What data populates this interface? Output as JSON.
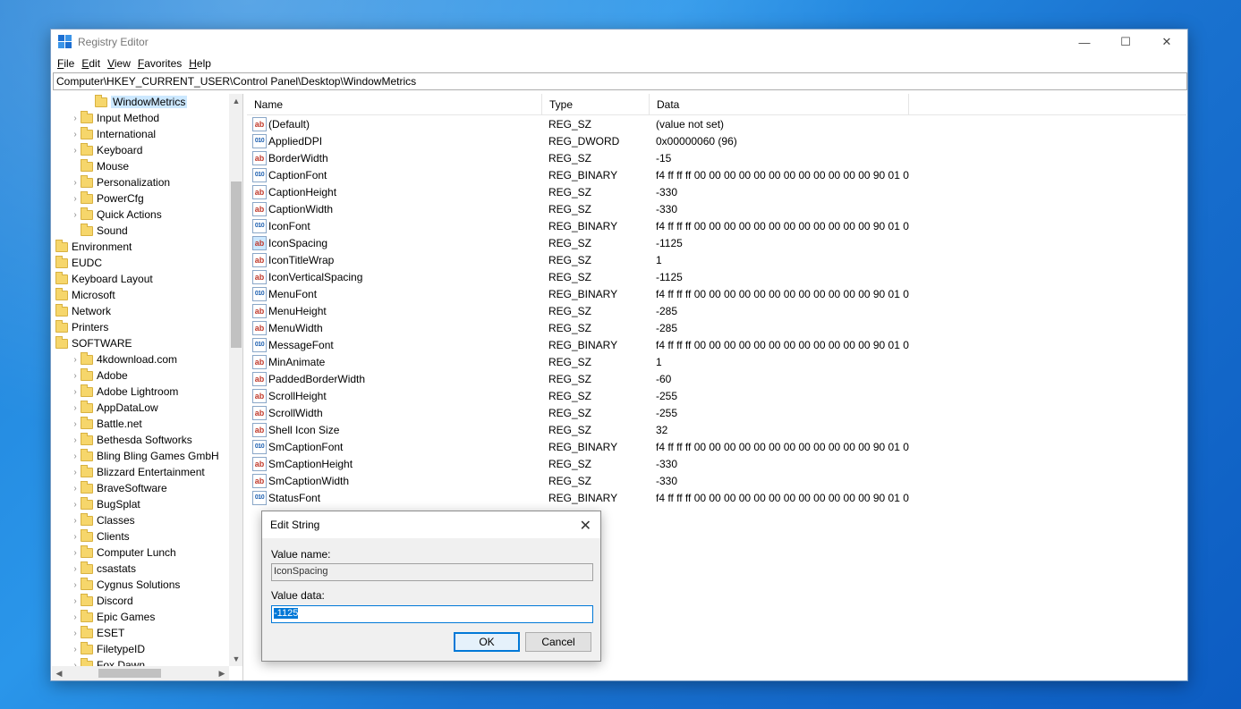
{
  "window": {
    "title": "Registry Editor",
    "controls": {
      "minimize": "—",
      "maximize": "☐",
      "close": "✕"
    }
  },
  "menu": [
    {
      "label": "File",
      "u": "F",
      "rest": "ile"
    },
    {
      "label": "Edit",
      "u": "E",
      "rest": "dit"
    },
    {
      "label": "View",
      "u": "V",
      "rest": "iew"
    },
    {
      "label": "Favorites",
      "u": "F",
      "rest": "avorites"
    },
    {
      "label": "Help",
      "u": "H",
      "rest": "elp"
    }
  ],
  "address": "Computer\\HKEY_CURRENT_USER\\Control Panel\\Desktop\\WindowMetrics",
  "tree": [
    {
      "label": "WindowMetrics",
      "indent": 2,
      "expander": false,
      "selected": true
    },
    {
      "label": "Input Method",
      "indent": 1,
      "expander": true
    },
    {
      "label": "International",
      "indent": 1,
      "expander": true
    },
    {
      "label": "Keyboard",
      "indent": 1,
      "expander": true
    },
    {
      "label": "Mouse",
      "indent": 1,
      "expander": false
    },
    {
      "label": "Personalization",
      "indent": 1,
      "expander": true
    },
    {
      "label": "PowerCfg",
      "indent": 1,
      "expander": true
    },
    {
      "label": "Quick Actions",
      "indent": 1,
      "expander": true
    },
    {
      "label": "Sound",
      "indent": 1,
      "expander": false
    },
    {
      "label": "Environment",
      "indent": 0,
      "expander": false
    },
    {
      "label": "EUDC",
      "indent": 0,
      "expander": false
    },
    {
      "label": "Keyboard Layout",
      "indent": 0,
      "expander": false
    },
    {
      "label": "Microsoft",
      "indent": 0,
      "expander": false
    },
    {
      "label": "Network",
      "indent": 0,
      "expander": false
    },
    {
      "label": "Printers",
      "indent": 0,
      "expander": false
    },
    {
      "label": "SOFTWARE",
      "indent": 0,
      "expander": false
    },
    {
      "label": "4kdownload.com",
      "indent": 1,
      "expander": true
    },
    {
      "label": "Adobe",
      "indent": 1,
      "expander": true
    },
    {
      "label": "Adobe Lightroom",
      "indent": 1,
      "expander": true
    },
    {
      "label": "AppDataLow",
      "indent": 1,
      "expander": true
    },
    {
      "label": "Battle.net",
      "indent": 1,
      "expander": true
    },
    {
      "label": "Bethesda Softworks",
      "indent": 1,
      "expander": true
    },
    {
      "label": "Bling Bling Games GmbH",
      "indent": 1,
      "expander": true
    },
    {
      "label": "Blizzard Entertainment",
      "indent": 1,
      "expander": true
    },
    {
      "label": "BraveSoftware",
      "indent": 1,
      "expander": true
    },
    {
      "label": "BugSplat",
      "indent": 1,
      "expander": true
    },
    {
      "label": "Classes",
      "indent": 1,
      "expander": true
    },
    {
      "label": "Clients",
      "indent": 1,
      "expander": true
    },
    {
      "label": "Computer Lunch",
      "indent": 1,
      "expander": true
    },
    {
      "label": "csastats",
      "indent": 1,
      "expander": true
    },
    {
      "label": "Cygnus Solutions",
      "indent": 1,
      "expander": true
    },
    {
      "label": "Discord",
      "indent": 1,
      "expander": true
    },
    {
      "label": "Epic Games",
      "indent": 1,
      "expander": true
    },
    {
      "label": "ESET",
      "indent": 1,
      "expander": true
    },
    {
      "label": "FiletypeID",
      "indent": 1,
      "expander": true
    },
    {
      "label": "Fox Dawn",
      "indent": 1,
      "expander": true
    }
  ],
  "columns": {
    "name": "Name",
    "type": "Type",
    "data": "Data"
  },
  "values": [
    {
      "name": "(Default)",
      "type": "REG_SZ",
      "data": "(value not set)",
      "kind": "sz"
    },
    {
      "name": "AppliedDPI",
      "type": "REG_DWORD",
      "data": "0x00000060 (96)",
      "kind": "bin"
    },
    {
      "name": "BorderWidth",
      "type": "REG_SZ",
      "data": "-15",
      "kind": "sz"
    },
    {
      "name": "CaptionFont",
      "type": "REG_BINARY",
      "data": "f4 ff ff ff 00 00 00 00 00 00 00 00 00 00 00 00 90 01 0...",
      "kind": "bin"
    },
    {
      "name": "CaptionHeight",
      "type": "REG_SZ",
      "data": "-330",
      "kind": "sz"
    },
    {
      "name": "CaptionWidth",
      "type": "REG_SZ",
      "data": "-330",
      "kind": "sz"
    },
    {
      "name": "IconFont",
      "type": "REG_BINARY",
      "data": "f4 ff ff ff 00 00 00 00 00 00 00 00 00 00 00 00 90 01 0...",
      "kind": "bin"
    },
    {
      "name": "IconSpacing",
      "type": "REG_SZ",
      "data": "-1125",
      "kind": "sz",
      "selected": true
    },
    {
      "name": "IconTitleWrap",
      "type": "REG_SZ",
      "data": "1",
      "kind": "sz"
    },
    {
      "name": "IconVerticalSpacing",
      "type": "REG_SZ",
      "data": "-1125",
      "kind": "sz"
    },
    {
      "name": "MenuFont",
      "type": "REG_BINARY",
      "data": "f4 ff ff ff 00 00 00 00 00 00 00 00 00 00 00 00 90 01 0...",
      "kind": "bin"
    },
    {
      "name": "MenuHeight",
      "type": "REG_SZ",
      "data": "-285",
      "kind": "sz"
    },
    {
      "name": "MenuWidth",
      "type": "REG_SZ",
      "data": "-285",
      "kind": "sz"
    },
    {
      "name": "MessageFont",
      "type": "REG_BINARY",
      "data": "f4 ff ff ff 00 00 00 00 00 00 00 00 00 00 00 00 90 01 0...",
      "kind": "bin"
    },
    {
      "name": "MinAnimate",
      "type": "REG_SZ",
      "data": "1",
      "kind": "sz"
    },
    {
      "name": "PaddedBorderWidth",
      "type": "REG_SZ",
      "data": "-60",
      "kind": "sz"
    },
    {
      "name": "ScrollHeight",
      "type": "REG_SZ",
      "data": "-255",
      "kind": "sz"
    },
    {
      "name": "ScrollWidth",
      "type": "REG_SZ",
      "data": "-255",
      "kind": "sz"
    },
    {
      "name": "Shell Icon Size",
      "type": "REG_SZ",
      "data": "32",
      "kind": "sz"
    },
    {
      "name": "SmCaptionFont",
      "type": "REG_BINARY",
      "data": "f4 ff ff ff 00 00 00 00 00 00 00 00 00 00 00 00 90 01 0...",
      "kind": "bin"
    },
    {
      "name": "SmCaptionHeight",
      "type": "REG_SZ",
      "data": "-330",
      "kind": "sz"
    },
    {
      "name": "SmCaptionWidth",
      "type": "REG_SZ",
      "data": "-330",
      "kind": "sz"
    },
    {
      "name": "StatusFont",
      "type": "REG_BINARY",
      "data": "f4 ff ff ff 00 00 00 00 00 00 00 00 00 00 00 00 90 01 0...",
      "kind": "bin"
    }
  ],
  "icons": {
    "sz": "ab",
    "bin": "010"
  },
  "dialog": {
    "title": "Edit String",
    "close": "✕",
    "value_name_label": "Value name:",
    "value_name": "IconSpacing",
    "value_data_label": "Value data:",
    "value_data": "-1125",
    "ok": "OK",
    "cancel": "Cancel"
  },
  "scroll": {
    "up": "▲",
    "down": "▼",
    "left": "◀",
    "right": "▶"
  }
}
